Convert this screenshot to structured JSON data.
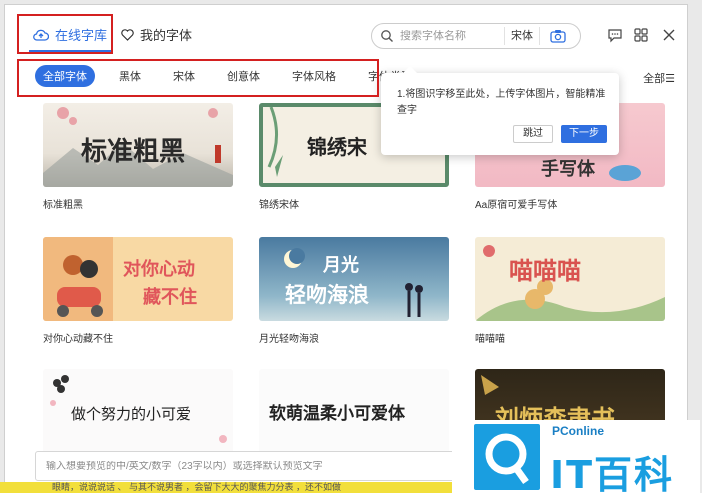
{
  "tabs": {
    "online": "在线字库",
    "mine": "我的字体"
  },
  "search": {
    "placeholder": "搜索字体名称",
    "font": "宋体"
  },
  "categories": [
    "全部字体",
    "黑体",
    "宋体",
    "创意体",
    "字体风格",
    "字体类型"
  ],
  "all_label": "全部",
  "tooltip": {
    "text": "1.将图识字移至此处，上传字体图片，智能精准查字",
    "skip": "跳过",
    "next": "下一步"
  },
  "cards": [
    {
      "label": "标准粗黑",
      "preview": "标准粗黑"
    },
    {
      "label": "锦绣宋体",
      "preview": "锦绣宋"
    },
    {
      "label": "Aa原宿可爱手写体",
      "preview": "手写体"
    },
    {
      "label": "对你心动藏不住",
      "preview_line1": "对你心动",
      "preview_line2": "藏不住"
    },
    {
      "label": "月光轻吻海浪",
      "preview_line1": "月光",
      "preview_line2": "轻吻海浪"
    },
    {
      "label": "喵喵喵",
      "preview": "喵喵喵"
    },
    {
      "label": "",
      "preview": "做个努力的小可爱"
    },
    {
      "label": "",
      "preview": "软萌温柔小可爱体"
    },
    {
      "label": "",
      "preview": "刘炳森隶书"
    }
  ],
  "preview_input": {
    "placeholder": "输入想要预览的中/英文/数字（23字以内）或选择默认预览文字"
  },
  "strip_text": "眼睛，说说说话 、 与其不说男者 ，会留下大大的聚焦力分表 ，还不如做",
  "watermark": {
    "small": "PConline",
    "big": "IT百科"
  },
  "colors": {
    "accent": "#2f6fe0",
    "highlight": "#d42020"
  }
}
